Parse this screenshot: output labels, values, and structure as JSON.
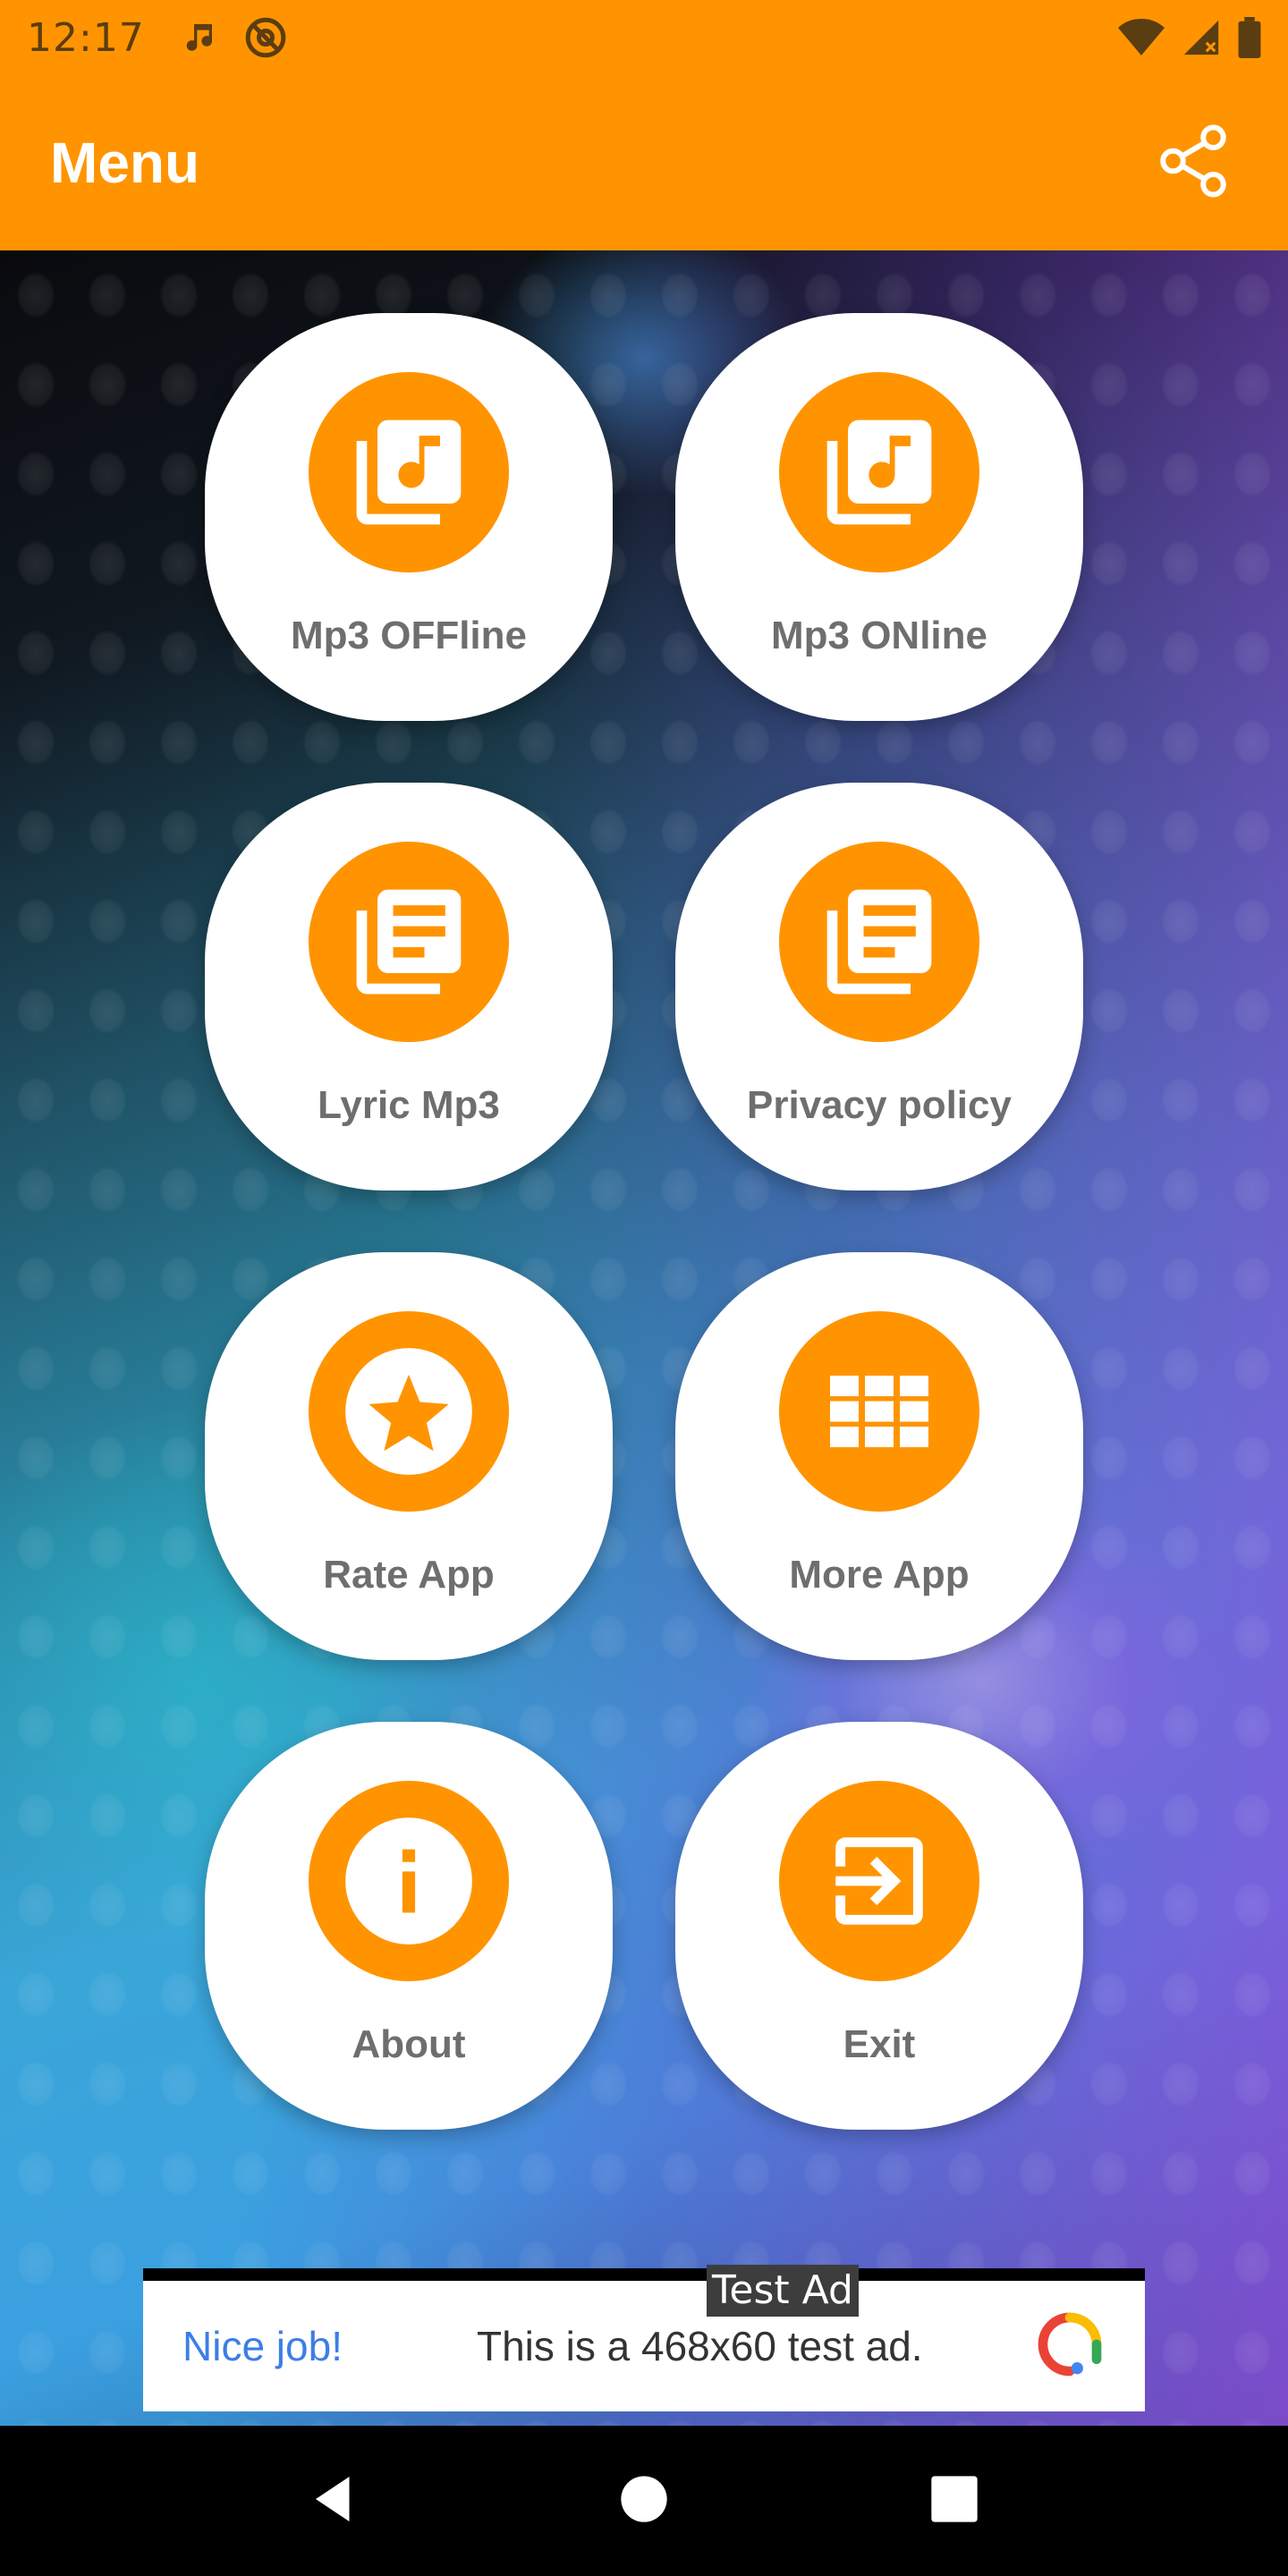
{
  "status_bar": {
    "time": "12:17",
    "icons_left": [
      "music-note-icon",
      "at-sign-icon"
    ],
    "icons_right": [
      "wifi-icon",
      "signal-icon",
      "battery-icon"
    ]
  },
  "app_bar": {
    "title": "Menu",
    "share_icon": "share-icon",
    "color": "#ff9400"
  },
  "menu": {
    "items": [
      {
        "label": "Mp3 OFFline",
        "icon": "music-library-icon"
      },
      {
        "label": "Mp3 ONline",
        "icon": "music-library-icon"
      },
      {
        "label": "Lyric Mp3",
        "icon": "text-library-icon"
      },
      {
        "label": "Privacy policy",
        "icon": "text-library-icon"
      },
      {
        "label": "Rate App",
        "icon": "star-icon"
      },
      {
        "label": "More App",
        "icon": "grid-icon"
      },
      {
        "label": "About",
        "icon": "info-icon"
      },
      {
        "label": "Exit",
        "icon": "exit-icon"
      }
    ],
    "accent_color": "#ff9400",
    "label_color": "#6e6e6e"
  },
  "ad": {
    "tag": "Test Ad",
    "headline": "Nice job!",
    "text": "This is a 468x60 test ad.",
    "logo_icon": "ad-logo-icon"
  },
  "nav_bar": {
    "buttons": [
      "back-icon",
      "home-icon",
      "recents-icon"
    ]
  }
}
